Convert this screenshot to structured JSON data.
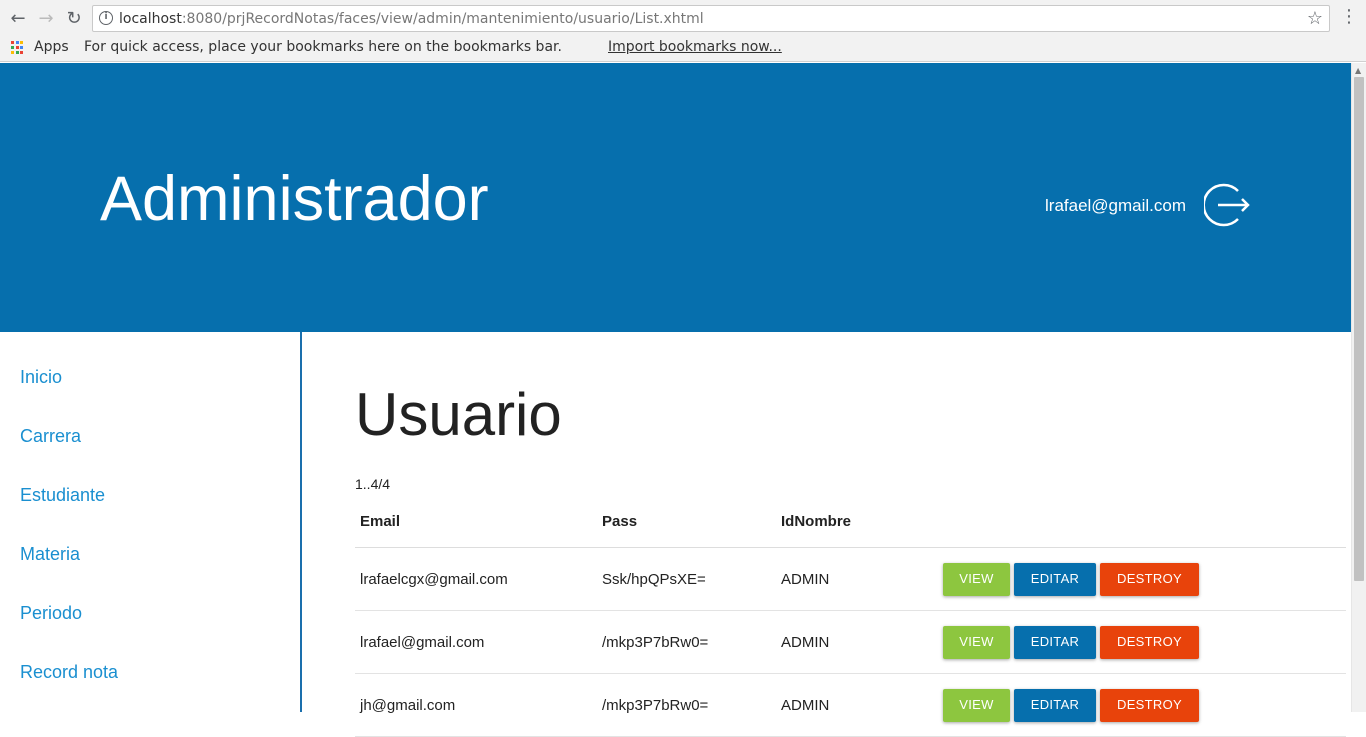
{
  "browser": {
    "url_host": "localhost",
    "url_rest": ":8080/prjRecordNotas/faces/view/admin/mantenimiento/usuario/List.xhtml",
    "bookmarks": {
      "apps_label": "Apps",
      "hint_text": "For quick access, place your bookmarks here on the bookmarks bar.",
      "import_link": "Import bookmarks now..."
    }
  },
  "header": {
    "title": "Administrador",
    "user_email": "lrafael@gmail.com"
  },
  "sidebar": {
    "items": [
      {
        "label": "Inicio"
      },
      {
        "label": "Carrera"
      },
      {
        "label": "Estudiante"
      },
      {
        "label": "Materia"
      },
      {
        "label": "Periodo"
      },
      {
        "label": "Record nota"
      }
    ]
  },
  "main": {
    "title": "Usuario",
    "pager": "1..4/4",
    "columns": [
      "Email",
      "Pass",
      "IdNombre"
    ],
    "rows": [
      {
        "email": "lrafaelcgx@gmail.com",
        "pass": "Ssk/hpQPsXE=",
        "idnombre": "ADMIN"
      },
      {
        "email": "lrafael@gmail.com",
        "pass": "/mkp3P7bRw0=",
        "idnombre": "ADMIN"
      },
      {
        "email": "jh@gmail.com",
        "pass": "/mkp3P7bRw0=",
        "idnombre": "ADMIN"
      }
    ],
    "actions": {
      "view": "VIEW",
      "edit": "EDITAR",
      "destroy": "DESTROY"
    }
  },
  "colors": {
    "header_bg": "#066fad",
    "link": "#1a8fd0",
    "view_btn": "#8dc63f",
    "edit_btn": "#066fad",
    "destroy_btn": "#e8430b"
  }
}
